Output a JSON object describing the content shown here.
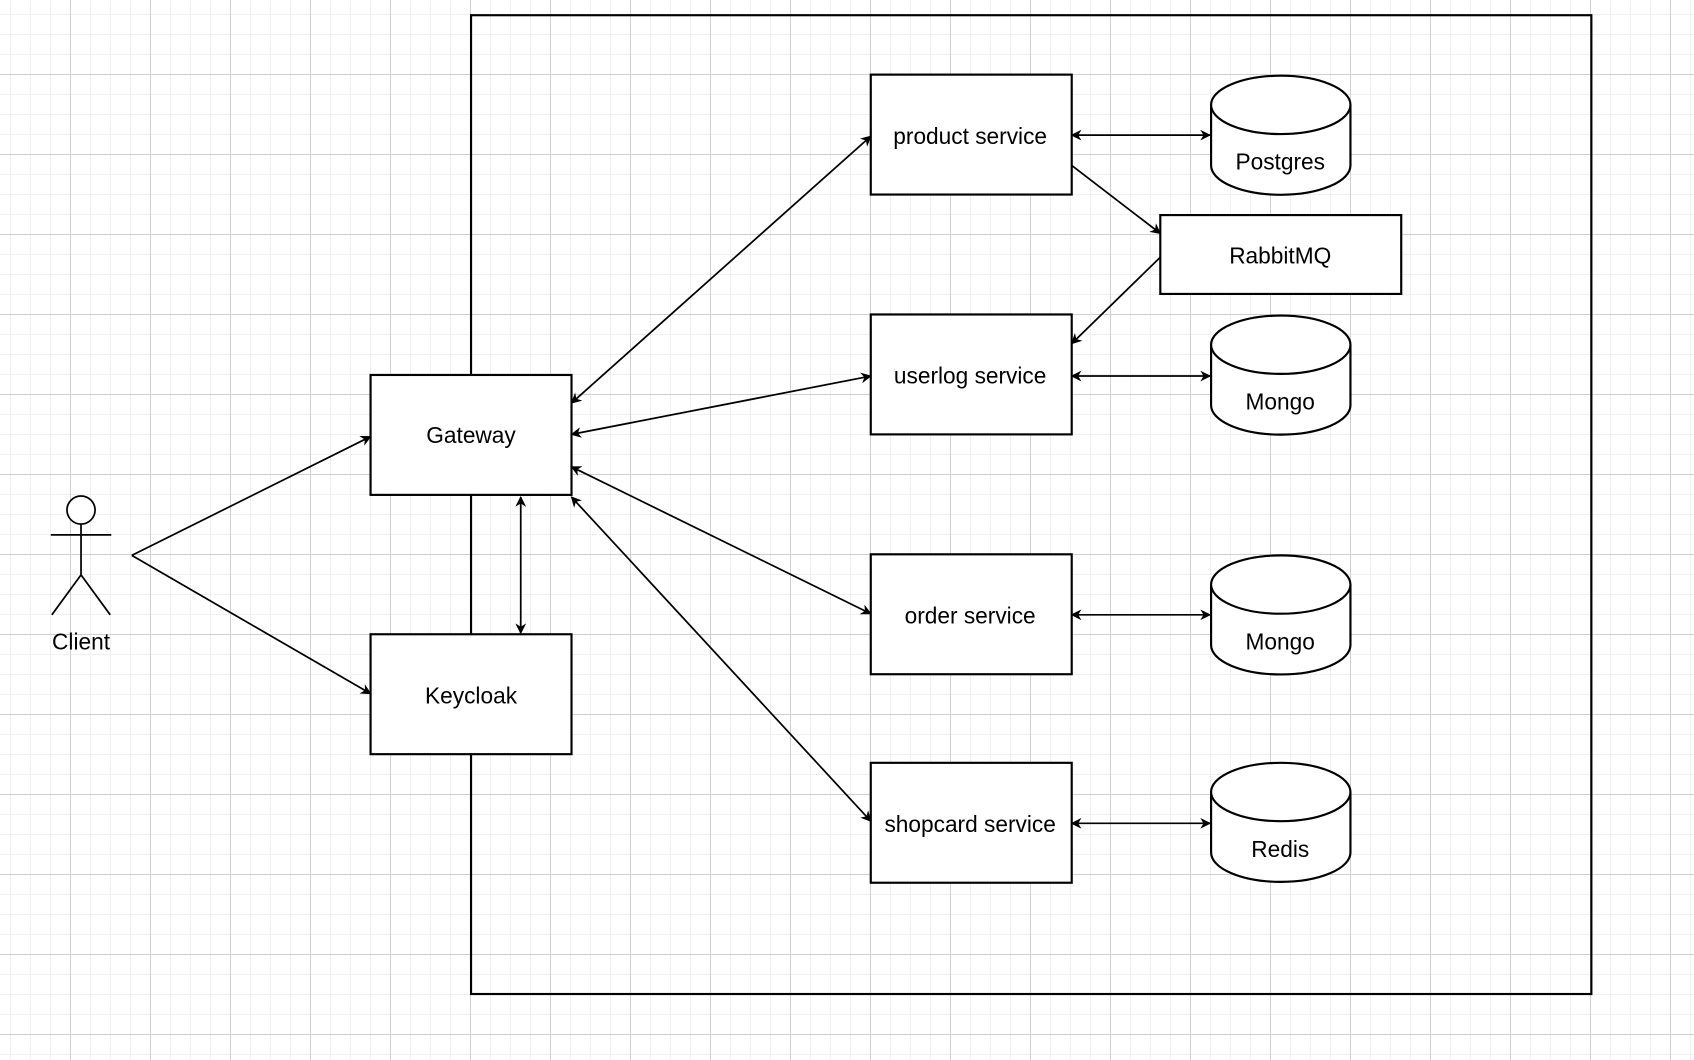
{
  "diagram": {
    "actor": {
      "label": "Client"
    },
    "nodes": {
      "gateway": "Gateway",
      "keycloak": "Keycloak",
      "product": "product service",
      "userlog": "userlog service",
      "order": "order service",
      "shopcard": "shopcard service",
      "rabbitmq": "RabbitMQ",
      "postgres": "Postgres",
      "mongo1": "Mongo",
      "mongo2": "Mongo",
      "redis": "Redis"
    }
  }
}
